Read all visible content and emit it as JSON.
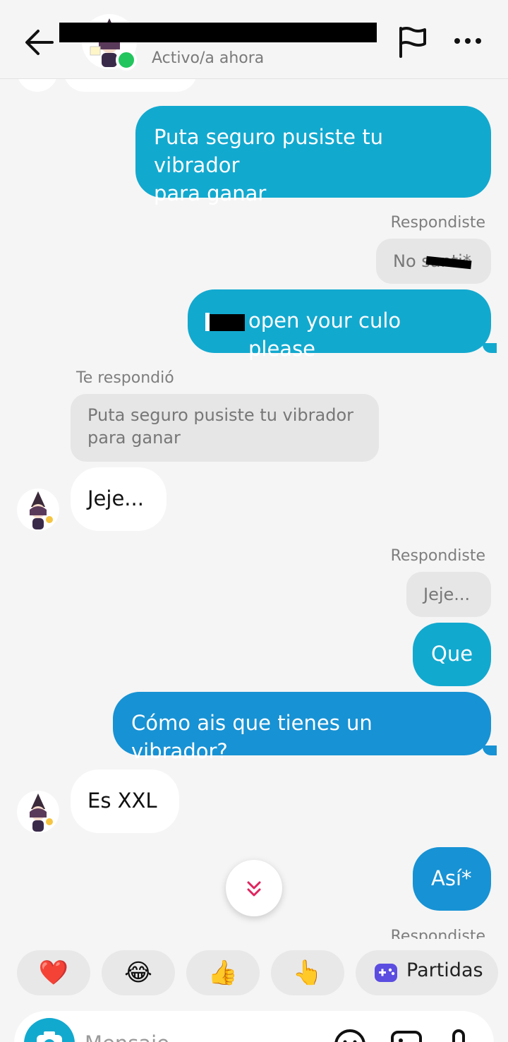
{
  "header": {
    "status": "Activo/a ahora"
  },
  "messages": {
    "m1": "Puta seguro pusiste tu vibrador\npara ganar",
    "reply1_label": "Respondiste",
    "reply1_quote": "No santi*",
    "m2": "open your culo please",
    "reply2_label": "Te respondió",
    "reply2_quote": "Puta seguro pusiste tu vibrador\npara ganar",
    "m3": "Jeje...",
    "reply3_label": "Respondiste",
    "reply3_quote": "Jeje...",
    "m4": "Que",
    "m5": "Cómo ais que tienes un vibrador?",
    "m6": "Es XXL",
    "m7": "Así*",
    "reply4_label": "Respondiste"
  },
  "reactions": {
    "heart": "❤️",
    "laugh": "😂",
    "thumbs": "👍",
    "point": "👆",
    "partidas": "Partidas"
  },
  "composer": {
    "placeholder": "Mensaje"
  },
  "colors": {
    "outgoing": "#12a9cf",
    "outgoing_dark": "#1792d4",
    "online": "#22c55e",
    "scroll_accent": "#e0245e"
  }
}
